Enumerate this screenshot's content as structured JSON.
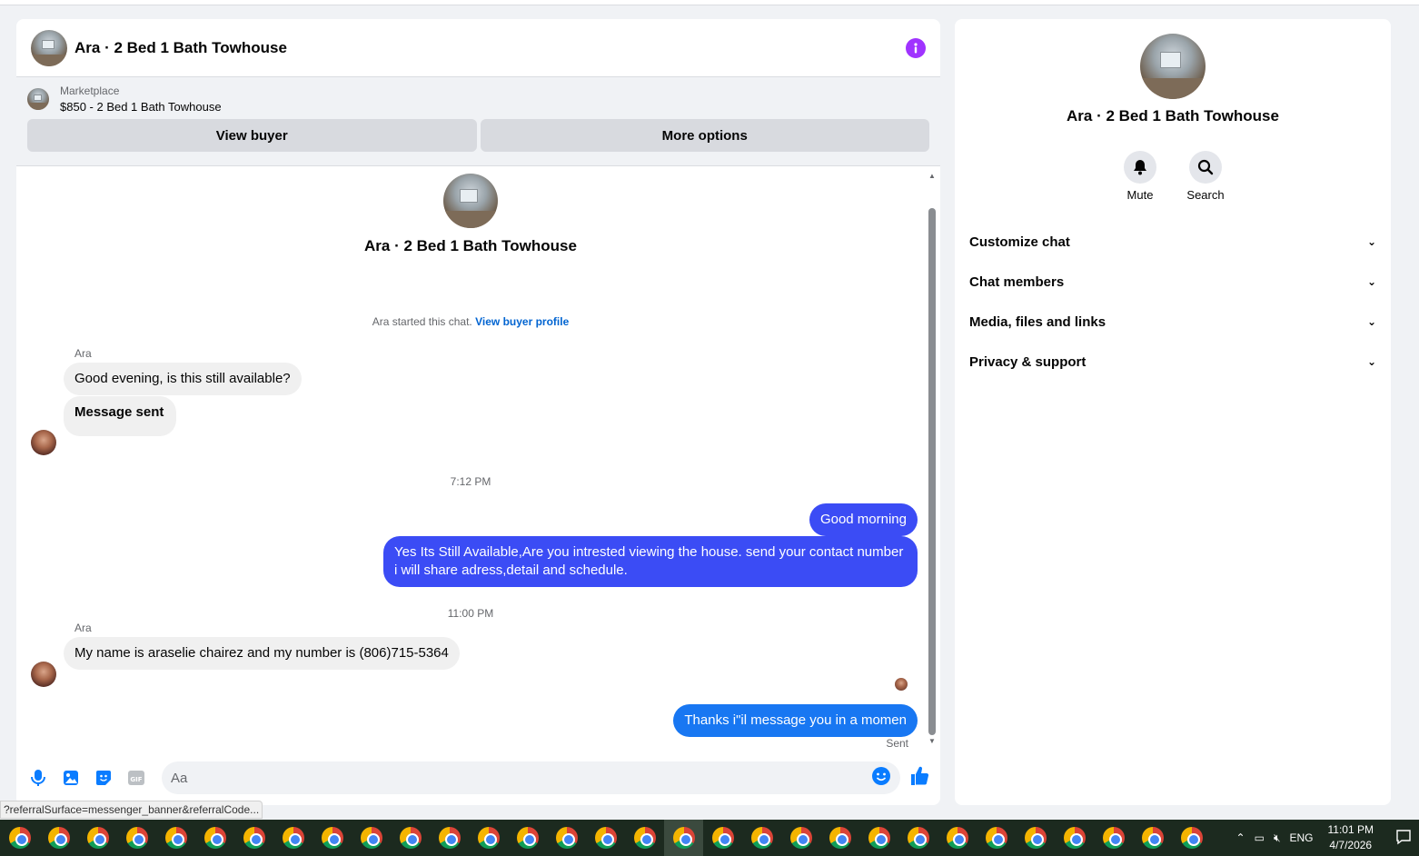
{
  "chat": {
    "title": "Ara · 2 Bed 1 Bath Towhouse",
    "marketplace": {
      "label": "Marketplace",
      "listing": "$850 - 2 Bed 1 Bath Towhouse",
      "view_buyer": "View buyer",
      "more_options": "More options"
    },
    "intro_name": "Ara · 2 Bed 1 Bath Towhouse",
    "started_text": "Ara started this chat.",
    "view_buyer_profile": "View buyer profile",
    "messages": [
      {
        "sender": "Ara",
        "text": "Good evening, is this still available?"
      },
      {
        "text": "Message sent"
      },
      {
        "timestamp": "7:12 PM"
      },
      {
        "text": "Good morning"
      },
      {
        "text": "Yes Its Still Available,Are you intrested viewing the house. send your contact number i will share adress,detail and schedule."
      },
      {
        "timestamp": "11:00 PM"
      },
      {
        "sender": "Ara",
        "text": "My name is araselie chairez and my number is (806)715-5364"
      },
      {
        "text": "Thanks i\"il message you in a momen"
      }
    ],
    "sent_status": "Sent",
    "composer": {
      "placeholder": "Aa"
    }
  },
  "side": {
    "name": "Ara · 2 Bed 1 Bath Towhouse",
    "actions": [
      {
        "label": "Mute"
      },
      {
        "label": "Search"
      }
    ],
    "sections": [
      "Customize chat",
      "Chat members",
      "Media, files and links",
      "Privacy & support"
    ]
  },
  "status_url": "?referralSurface=messenger_banner&referralCode...",
  "taskbar": {
    "app_count": 31,
    "lang": "ENG",
    "time": "11:01 PM",
    "date": "4/7/2026"
  },
  "colors": {
    "accent": "#0064d1",
    "outgoing_bubble": "#3b4cf5",
    "info_icon": "#a033ff"
  }
}
